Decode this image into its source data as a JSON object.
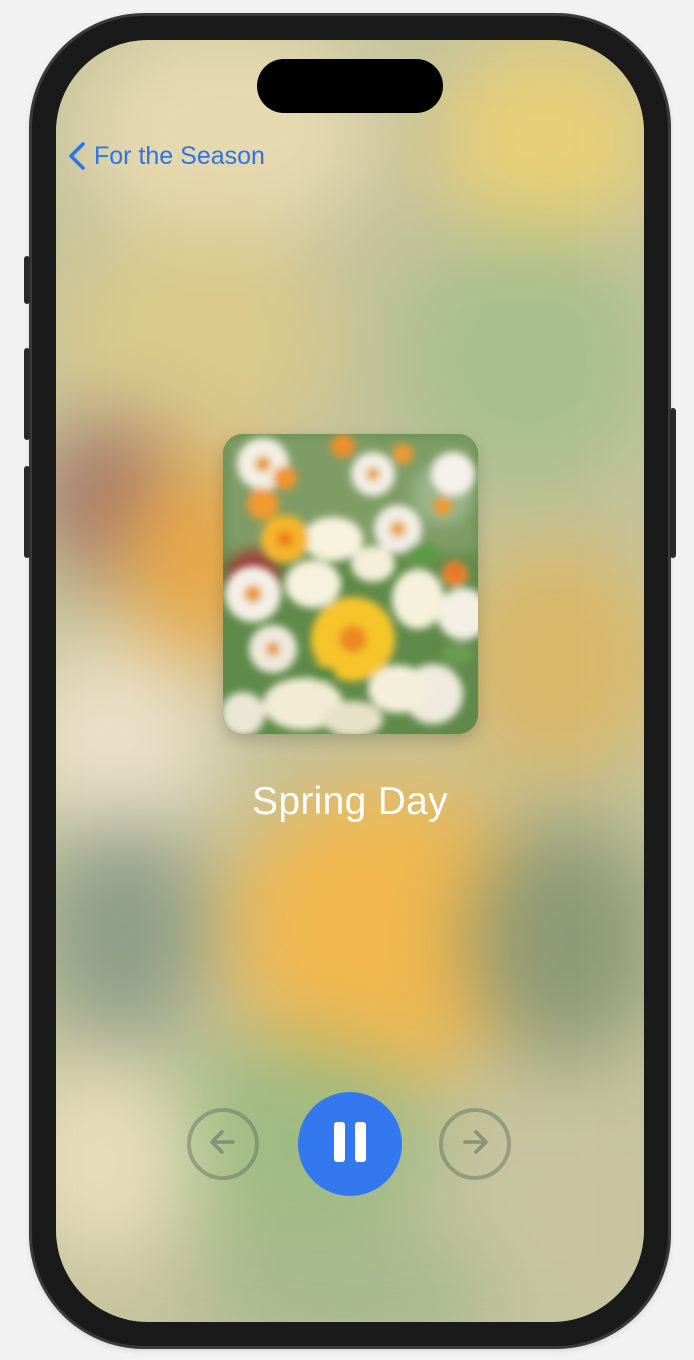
{
  "nav": {
    "back_label": "For the Season",
    "back_icon": "chevron-left-icon"
  },
  "now_playing": {
    "title": "Spring Day",
    "artwork_alt": "Blurred photo of white daisies, white lilies and yellow-orange flowers"
  },
  "controls": {
    "previous_icon": "arrow-left-circle-icon",
    "play_pause_icon": "pause-icon",
    "next_icon": "arrow-right-circle-icon",
    "state": "playing"
  },
  "colors": {
    "accent": "#3478F0",
    "link": "#2F73E6",
    "title_text": "#FFFFFF"
  }
}
